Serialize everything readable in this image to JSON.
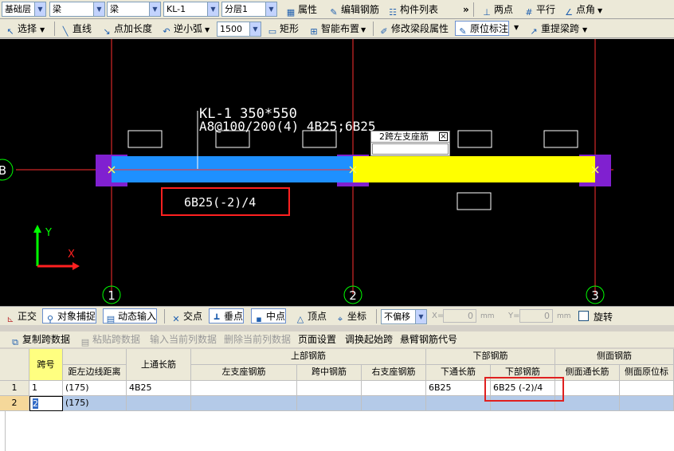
{
  "toolbar1": {
    "floor": "基础层",
    "category": "梁",
    "type": "梁",
    "element": "KL-1",
    "layer": "分层1",
    "property": "属性",
    "edit_rebar": "编辑钢筋",
    "component_list": "构件列表",
    "more": "»",
    "two_points": "两点",
    "parallel": "平行",
    "point_angle": "点角"
  },
  "toolbar2": {
    "select": "选择",
    "line": "直线",
    "point_length": "点加长度",
    "small_arc": "逆小弧",
    "radius": "1500",
    "rect": "矩形",
    "smart_layout": "智能布置",
    "modify_span": "修改梁段属性",
    "original_mark": "原位标注",
    "repick_span": "重提梁跨"
  },
  "canvas": {
    "beam_label_1": "KL-1 350*550",
    "beam_label_2": "A8@100/200(4) 4B25;6B25",
    "popup_title": "2跨左支座筋",
    "bottom_rebar": "6B25(-2)/4",
    "axis_b": "B",
    "axis_1": "1",
    "axis_2": "2",
    "axis_3": "3",
    "y_axis": "Y",
    "x_axis": "X"
  },
  "status": {
    "ortho": "正交",
    "snap": "对象捕捉",
    "dynamic": "动态输入",
    "intersect": "交点",
    "perp": "垂点",
    "mid": "中点",
    "vertex": "顶点",
    "coord": "坐标",
    "offset": "不偏移",
    "x_label": "X=",
    "x_val": "0",
    "unit": "mm",
    "y_label": "Y=",
    "y_val": "0",
    "rotate": "旋转"
  },
  "grid_tools": {
    "copy": "复制跨数据",
    "paste": "粘贴跨数据",
    "input_col": "输入当前列数据",
    "delete_col": "删除当前列数据",
    "page_setup": "页面设置",
    "swap_span": "调换起始跨",
    "cantilever": "悬臂钢筋代号"
  },
  "grid": {
    "headers": {
      "span_no": "跨号",
      "dist": "距左边线距离",
      "top_through": "上通长筋",
      "top_group": "上部钢筋",
      "left_seat": "左支座钢筋",
      "mid_span": "跨中钢筋",
      "right_seat": "右支座钢筋",
      "bottom_group": "下部钢筋",
      "bottom_through": "下通长筋",
      "bottom_rebar": "下部钢筋",
      "side_group": "侧面钢筋",
      "side_through": "侧面通长筋",
      "side_orig": "侧面原位标"
    },
    "rows": [
      {
        "no": "1",
        "span": "1",
        "dist": "(175)",
        "top": "4B25",
        "bottom_through": "6B25",
        "bottom": "6B25 (-2)/4"
      },
      {
        "no": "2",
        "span": "2",
        "dist": "(175)",
        "top": "",
        "bottom_through": "",
        "bottom": ""
      }
    ]
  }
}
